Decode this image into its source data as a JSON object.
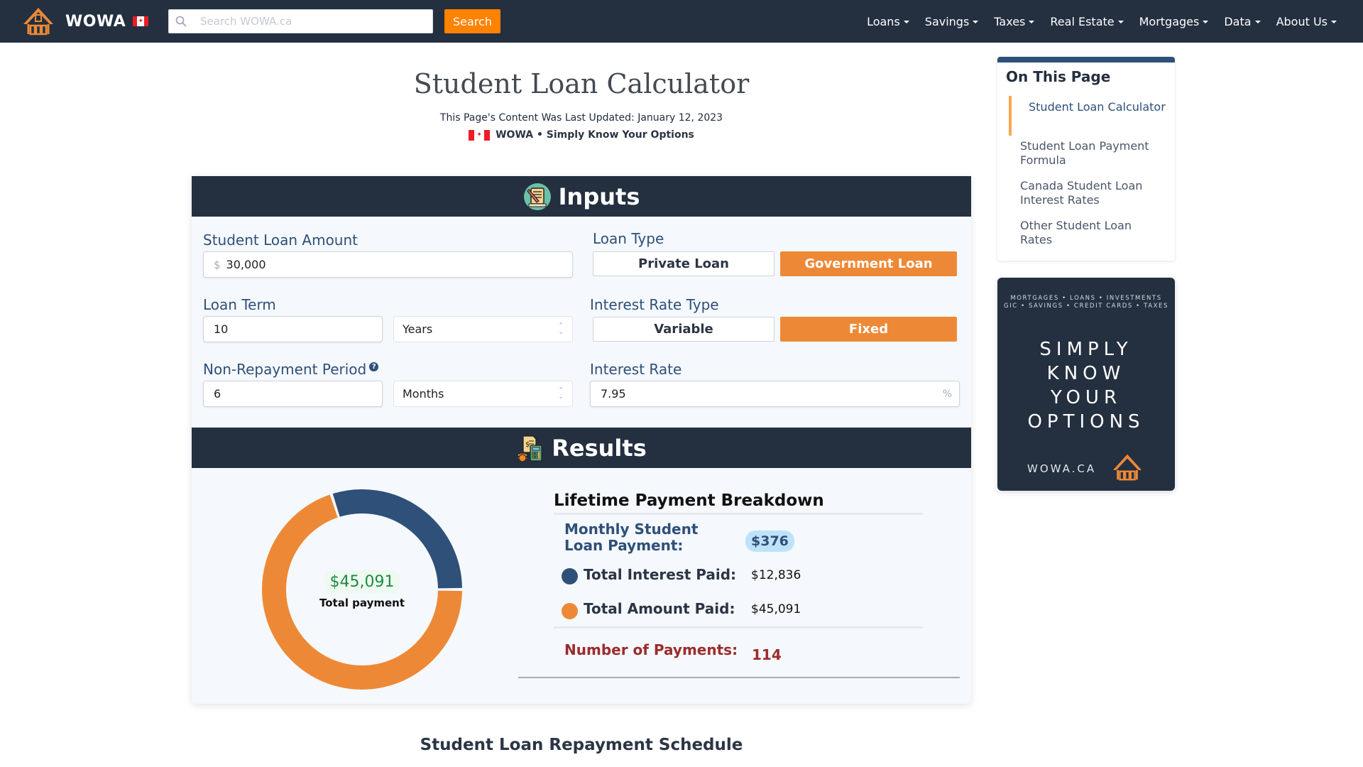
{
  "navbar": {
    "brand": "WOWA",
    "search_placeholder": "Search WOWA.ca",
    "search_button": "Search",
    "menu": [
      "Loans",
      "Savings",
      "Taxes",
      "Real Estate",
      "Mortgages",
      "Data",
      "About Us"
    ]
  },
  "header": {
    "title": "Student Loan Calculator",
    "updated": "This Page's Content Was Last Updated: January 12, 2023",
    "tagline": "WOWA • Simply Know Your Options"
  },
  "inputs": {
    "section_title": "Inputs",
    "loan_amount": {
      "label": "Student Loan Amount",
      "prefix": "$",
      "value": "30,000"
    },
    "loan_type": {
      "label": "Loan Type",
      "options": [
        "Private Loan",
        "Government Loan"
      ],
      "selected": "Government Loan"
    },
    "loan_term": {
      "label": "Loan Term",
      "value": "10",
      "unit": "Years"
    },
    "interest_rate_type": {
      "label": "Interest Rate Type",
      "options": [
        "Variable",
        "Fixed"
      ],
      "selected": "Fixed"
    },
    "non_repayment": {
      "label": "Non-Repayment Period",
      "help": "?",
      "value": "6",
      "unit": "Months"
    },
    "interest_rate": {
      "label": "Interest Rate",
      "value": "7.95",
      "suffix": "%"
    }
  },
  "results": {
    "section_title": "Results",
    "donut": {
      "center_value": "$45,091",
      "center_label": "Total payment",
      "segments": [
        {
          "name": "Total Interest Paid",
          "value": 12836,
          "color": "#2e5079"
        },
        {
          "name": "Total Amount Paid (principal)",
          "value": 30000,
          "color": "#ed8936"
        }
      ]
    },
    "breakdown": {
      "title": "Lifetime Payment Breakdown",
      "monthly_label": "Monthly Student Loan Payment:",
      "monthly_value": "$376",
      "interest_label": "Total Interest Paid:",
      "interest_value": "$12,836",
      "total_label": "Total Amount Paid:",
      "total_value": "$45,091",
      "payments_label": "Number of Payments:",
      "payments_value": "114"
    },
    "colors": {
      "interest": "#2e5079",
      "total": "#ed8936"
    }
  },
  "schedule_title": "Student Loan Repayment Schedule",
  "toc": {
    "title": "On This Page",
    "items": [
      {
        "label": "Student Loan Calculator",
        "active": true
      },
      {
        "label": "Student Loan Payment Formula",
        "active": false
      },
      {
        "label": "Canada Student Loan Interest Rates",
        "active": false
      },
      {
        "label": "Other Student Loan Rates",
        "active": false
      }
    ]
  },
  "ad": {
    "top_line1": "MORTGAGES • LOANS • INVESTMENTS",
    "top_line2": "GIC • SAVINGS • CREDIT CARDS • TAXES",
    "big": [
      "SIMPLY",
      "KNOW",
      "YOUR",
      "OPTIONS"
    ],
    "footer": "WOWA.CA"
  }
}
